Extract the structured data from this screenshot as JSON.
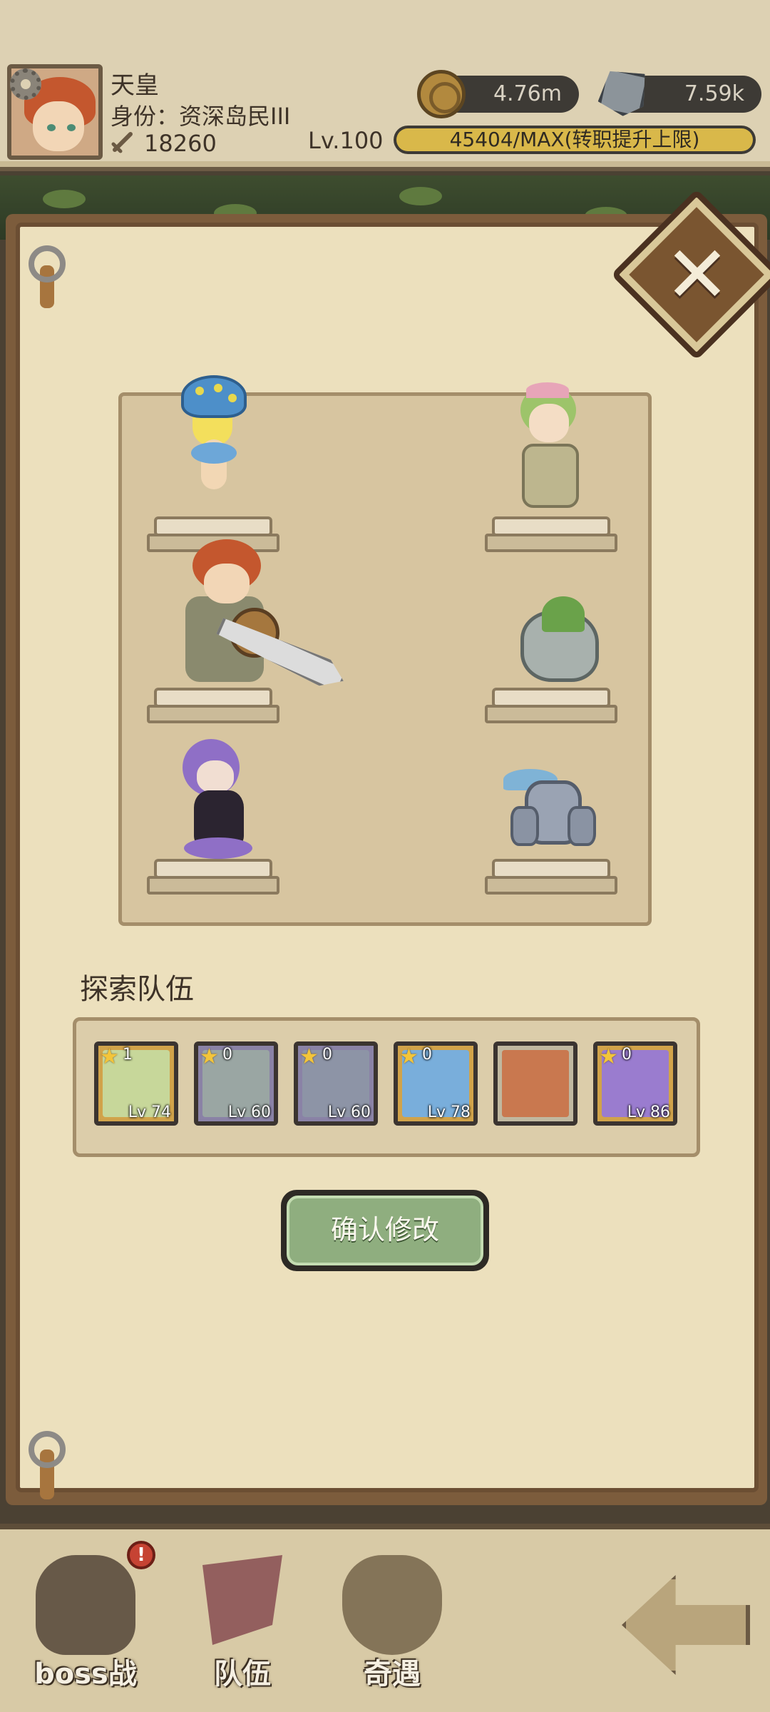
{
  "header": {
    "player_name": "天皇",
    "player_title": "身份：资深岛民III",
    "power": "18260",
    "level": "Lv.100",
    "exp_text": "45404/MAX(转职提升上限)",
    "exp_progress": 1.0
  },
  "currencies": {
    "coins": "4.76m",
    "stones": "7.59k"
  },
  "formation": {
    "units": [
      {
        "name": "mushroom-girl",
        "icon": "mushroom-girl-icon"
      },
      {
        "name": "green-hair-girl",
        "icon": "green-hair-girl-icon"
      },
      {
        "name": "sword-hero",
        "icon": "sword-hero-icon"
      },
      {
        "name": "moss-rock",
        "icon": "moss-rock-icon"
      },
      {
        "name": "squid-girl",
        "icon": "squid-girl-icon"
      },
      {
        "name": "stone-golem",
        "icon": "stone-golem-icon"
      }
    ]
  },
  "team": {
    "title": "探索队伍",
    "members": [
      {
        "count": "1",
        "level": "Lv 74",
        "frame": "gold"
      },
      {
        "count": "0",
        "level": "Lv 60",
        "frame": "purple"
      },
      {
        "count": "0",
        "level": "Lv 60",
        "frame": "purple"
      },
      {
        "count": "0",
        "level": "Lv 78",
        "frame": "gold"
      },
      {
        "count": "",
        "level": "",
        "frame": "plain"
      },
      {
        "count": "0",
        "level": "Lv 86",
        "frame": "gold"
      }
    ]
  },
  "confirm_label": "确认修改",
  "nav": {
    "boss_label": "boss战",
    "team_label": "队伍",
    "adventure_label": "奇遇",
    "badge": "!"
  },
  "colors": {
    "parchment": "#ece0bd",
    "confirm_green": "#8fae7f",
    "exp_gold": "#d9b84a",
    "notify_red": "#c64333"
  }
}
